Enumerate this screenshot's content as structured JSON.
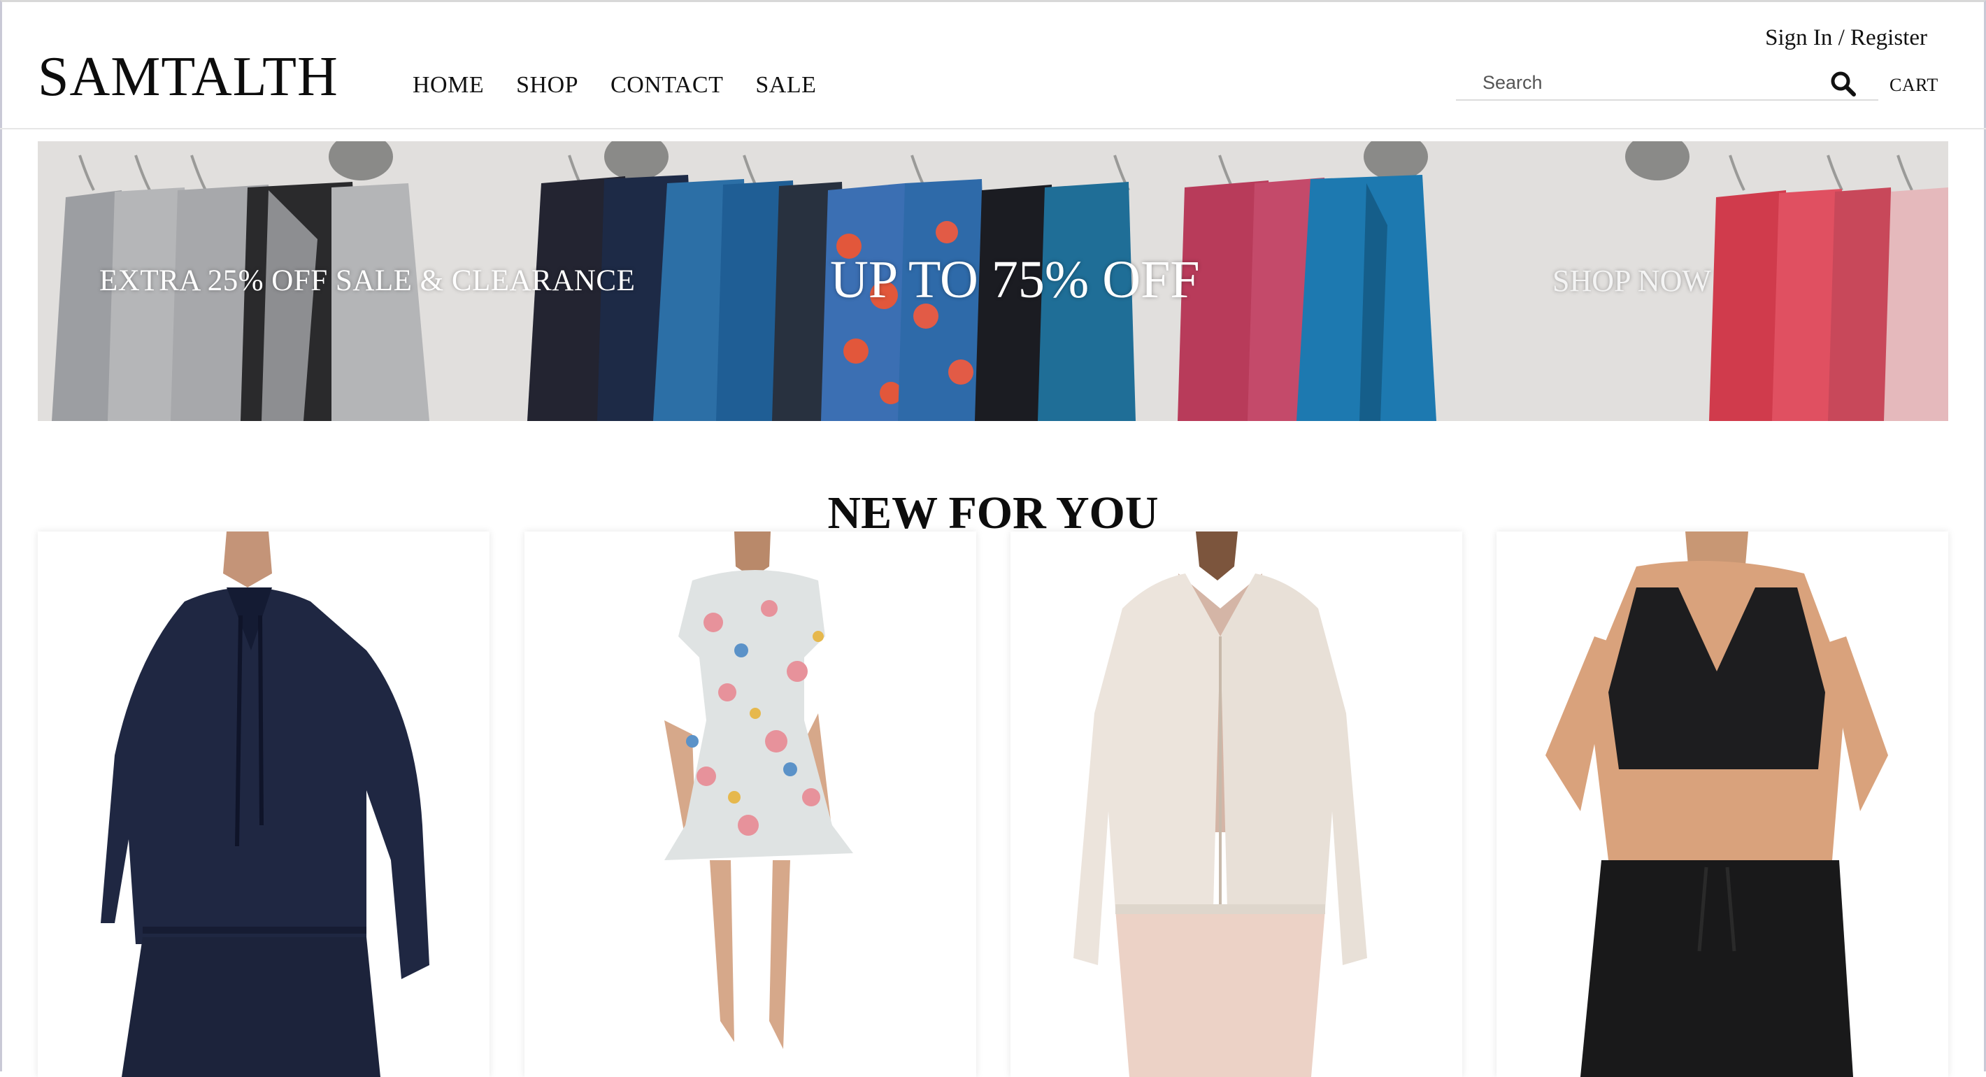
{
  "brand": {
    "logo_text": "SAMTALTH"
  },
  "nav": {
    "items": [
      "HOME",
      "SHOP",
      "CONTACT",
      "SALE"
    ]
  },
  "account": {
    "signin_label": "Sign In / Register"
  },
  "search": {
    "placeholder": "Search",
    "value": ""
  },
  "cart": {
    "label": "CART"
  },
  "banner": {
    "left_text": "EXTRA 25% OFF SALE & CLEARANCE",
    "center_text": "UP TO 75% OFF",
    "cta_text": "SHOP NOW"
  },
  "section": {
    "title": "NEW FOR YOU"
  },
  "products": [
    {
      "image_icon": "navy-hoodie-image"
    },
    {
      "image_icon": "floral-dress-image"
    },
    {
      "image_icon": "cream-jacket-image"
    },
    {
      "image_icon": "black-bra-top-image"
    }
  ],
  "colors": {
    "text": "#111111",
    "background": "#ffffff",
    "divider": "#e6e6e6"
  }
}
